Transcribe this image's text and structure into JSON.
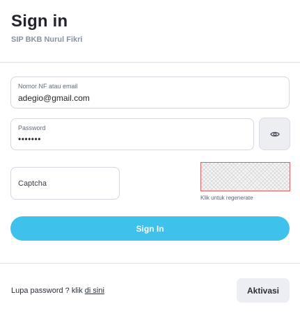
{
  "header": {
    "title": "Sign in",
    "subtitle": "SIP BKB Nurul Fikri"
  },
  "form": {
    "email_label": "Nomor NF atau email",
    "email_value": "adegio@gmail.com",
    "password_label": "Password",
    "password_value": "•••••••",
    "captcha_placeholder": "Captcha",
    "captcha_hint": "Klik untuk regenerate",
    "toggle_icon": "eye-icon",
    "submit_label": "Sign In",
    "accent_color": "#3ec1ea",
    "captcha_border_color": "#e06060"
  },
  "footer": {
    "forgot_text": "Lupa password ? klik ",
    "forgot_link": "di sini",
    "activate_label": "Aktivasi"
  }
}
